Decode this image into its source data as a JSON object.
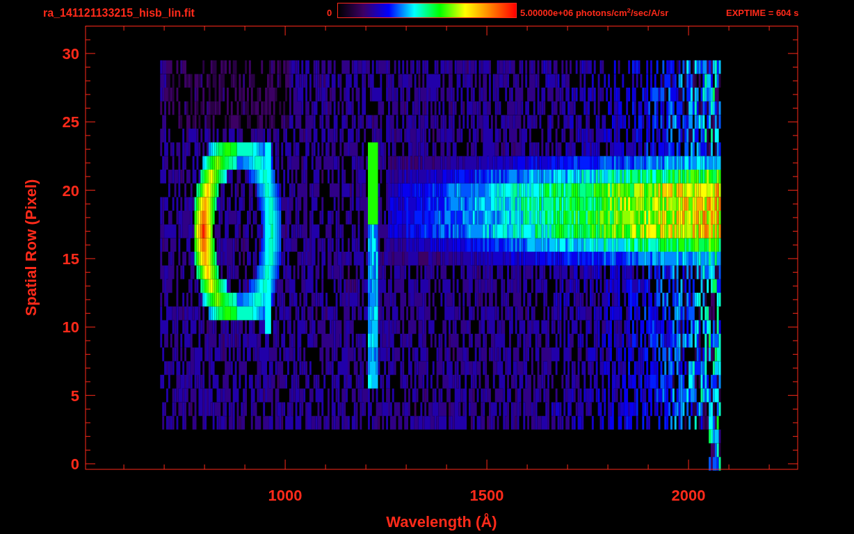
{
  "header": {
    "title": "ra_141121133215_hisb_lin.fit",
    "colorbar_min": "0",
    "colorbar_max": "5.00000e+06 photons/cm$^{2}$/sec/A/sr",
    "exptime": "EXPTIME = 604 s"
  },
  "plot": {
    "xlabel": "Wavelength (Å)",
    "ylabel": "Spatial Row (Pixel)",
    "xticks": [
      "1000",
      "1500",
      "2000"
    ],
    "yticks": [
      "30",
      "25",
      "20",
      "15",
      "10",
      "5",
      "0"
    ]
  }
}
